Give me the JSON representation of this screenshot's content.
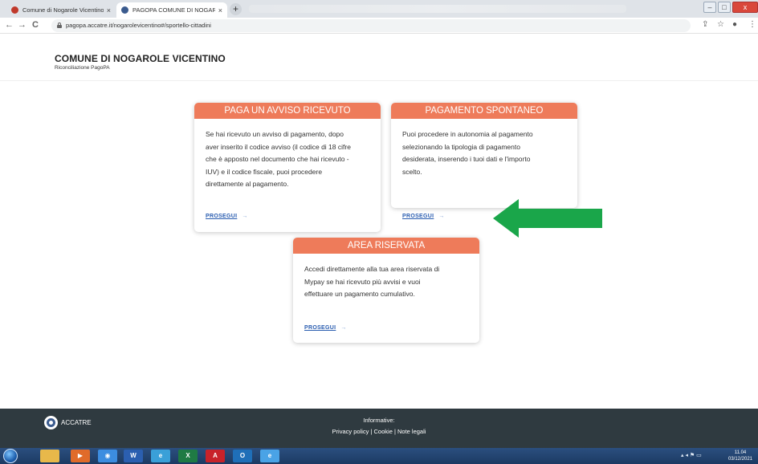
{
  "browser": {
    "tabs": [
      {
        "title": "Comune di Nogarole Vicentino",
        "close": "×",
        "favicon_color": "#c0392b"
      },
      {
        "title": "PAGOPA COMUNE DI NOGAROL…",
        "close": "×",
        "favicon_color": "#3b5b8e"
      }
    ],
    "new_tab": "+",
    "url": "pagopa.accatre.it/nogarolevicentino#/sportello-cittadini",
    "nav": {
      "back": "←",
      "forward": "→",
      "reload": "C"
    },
    "window_controls": {
      "minimize": "–",
      "maximize": "□",
      "close": "x"
    }
  },
  "header": {
    "title": "COMUNE DI NOGAROLE VICENTINO",
    "subtitle": "Riconciliazione PagoPA"
  },
  "cards": [
    {
      "title": "PAGA UN AVVISO RICEVUTO",
      "lines": [
        "Se hai ricevuto un avviso di pagamento, dopo",
        "aver inserito il codice avviso (il codice di 18 cifre",
        "che è apposto nel documento che hai ricevuto -",
        "IUV) e il codice fiscale, puoi procedere",
        "direttamente al pagamento."
      ],
      "link": "PROSEGUI",
      "arrow": "→"
    },
    {
      "title": "PAGAMENTO SPONTANEO",
      "lines": [
        "Puoi procedere in autonomia al pagamento",
        "selezionando la tipologia di pagamento",
        "desiderata, inserendo i tuoi dati e l'importo",
        "scelto."
      ],
      "link": "PROSEGUI",
      "arrow": "→"
    },
    {
      "title": "AREA RISERVATA",
      "lines": [
        "Accedi direttamente alla tua area riservata di",
        "Mypay se hai ricevuto più avvisi e vuoi",
        "effettuare un pagamento cumulativo."
      ],
      "link": "PROSEGUI",
      "arrow": "→"
    }
  ],
  "annotation_color": "#1aa64a",
  "accent_color": "#ee7b5a",
  "footer": {
    "brand": "ACCATRE",
    "info_title": "Informative:",
    "links": [
      "Privacy policy",
      "Cookie",
      "Note legali"
    ],
    "separator": " | "
  },
  "taskbar": {
    "apps": [
      {
        "name": "explorer",
        "color": "#e8b84a",
        "label": ""
      },
      {
        "name": "media-player",
        "color": "#e06b2a",
        "label": "▶"
      },
      {
        "name": "chrome",
        "color": "#3c8de0",
        "label": "◉"
      },
      {
        "name": "word",
        "color": "#2b5fb0",
        "label": "W"
      },
      {
        "name": "ie",
        "color": "#3aa0d8",
        "label": "e"
      },
      {
        "name": "excel",
        "color": "#1f7a44",
        "label": "X"
      },
      {
        "name": "acrobat",
        "color": "#c8222a",
        "label": "A"
      },
      {
        "name": "outlook",
        "color": "#1f6fb8",
        "label": "O"
      },
      {
        "name": "edge",
        "color": "#4aa3e6",
        "label": "e"
      }
    ],
    "clock_time": "11.04",
    "clock_date": "03/12/2021"
  }
}
